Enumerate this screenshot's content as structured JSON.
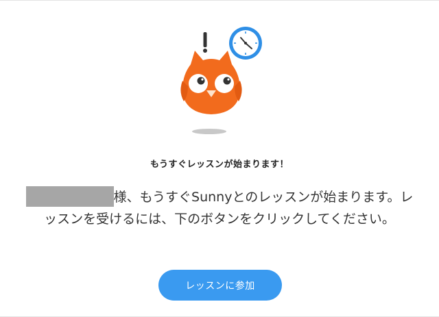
{
  "mascot": {
    "icon_name": "owl-mascot-icon",
    "alert_icon": "exclamation-icon",
    "clock_icon": "clock-icon"
  },
  "headline": "もうすぐレッスンが始まります！",
  "message": {
    "redacted_name": "",
    "text": "様、もうすぐSunnyとのレッスンが始まります。レッスンを受けるには、下のボタンをクリックしてください。"
  },
  "join_button": {
    "label": "レッスンに参加"
  },
  "colors": {
    "owl_orange": "#f26b1d",
    "button_blue": "#3a9af0",
    "clock_blue": "#2f8fe6",
    "redaction_gray": "#a6a6a6"
  }
}
